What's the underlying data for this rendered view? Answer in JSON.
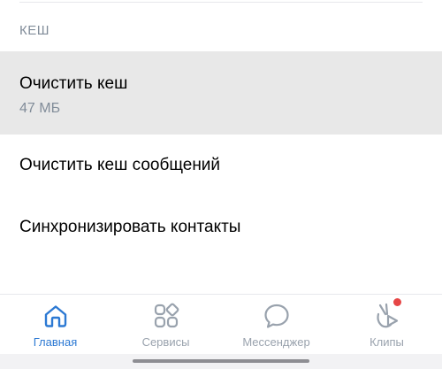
{
  "section": {
    "header": "КЕШ"
  },
  "items": [
    {
      "title": "Очистить кеш",
      "subtitle": "47 МБ"
    },
    {
      "title": "Очистить кеш сообщений"
    },
    {
      "title": "Синхронизировать контакты"
    }
  ],
  "tabbar": {
    "tabs": [
      {
        "label": "Главная",
        "icon": "home-icon",
        "active": true
      },
      {
        "label": "Сервисы",
        "icon": "services-grid-icon",
        "active": false
      },
      {
        "label": "Мессенджер",
        "icon": "messenger-bubble-icon",
        "active": false
      },
      {
        "label": "Клипы",
        "icon": "clips-icon",
        "active": false,
        "has_badge": true
      }
    ]
  },
  "colors": {
    "accent": "#2c79d3",
    "inactive": "#99a2ad",
    "secondary_text": "#818c99",
    "badge": "#e64646",
    "highlight": "#e8e8e8"
  }
}
